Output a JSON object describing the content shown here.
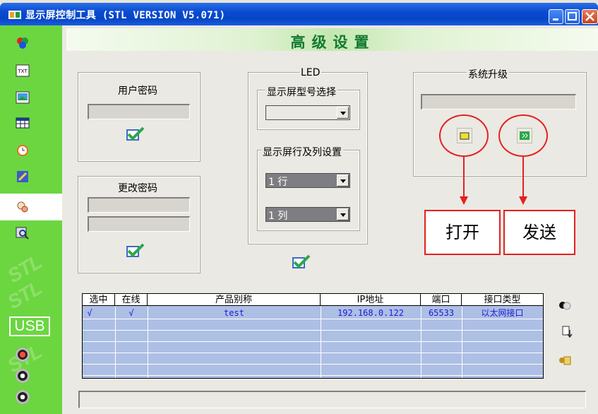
{
  "window": {
    "title": "显示屏控制工具 (STL VERSION V5.071)"
  },
  "header": {
    "title": "高级设置"
  },
  "sidebar": {
    "usb_label": "USB",
    "watermark": "STL",
    "icons": [
      "color-wheel-icon",
      "txt-icon",
      "image-icon",
      "table-icon",
      "clock-icon",
      "tool-icon",
      "settings-icon",
      "search-icon"
    ]
  },
  "user_password": {
    "label": "用户密码"
  },
  "change_password": {
    "label": "更改密码"
  },
  "led": {
    "group_label": "LED",
    "model_label": "显示屏型号选择",
    "rowcol_label": "显示屏行及列设置",
    "rows_value": "1 行",
    "cols_value": "1 列"
  },
  "upgrade": {
    "label": "系统升级"
  },
  "annotations": {
    "open": "打开",
    "send": "发送"
  },
  "table": {
    "headers": [
      "选中",
      "在线",
      "产品别称",
      "IP地址",
      "端口",
      "接口类型"
    ],
    "rows": [
      [
        "√",
        "√",
        "test",
        "192.168.0.122",
        "65533",
        "以太网接口"
      ]
    ]
  },
  "colors": {
    "sidebar": "#6cd641",
    "title_bar": "#0a4bd0",
    "header_text": "#127a30",
    "annotation": "#e52020"
  }
}
